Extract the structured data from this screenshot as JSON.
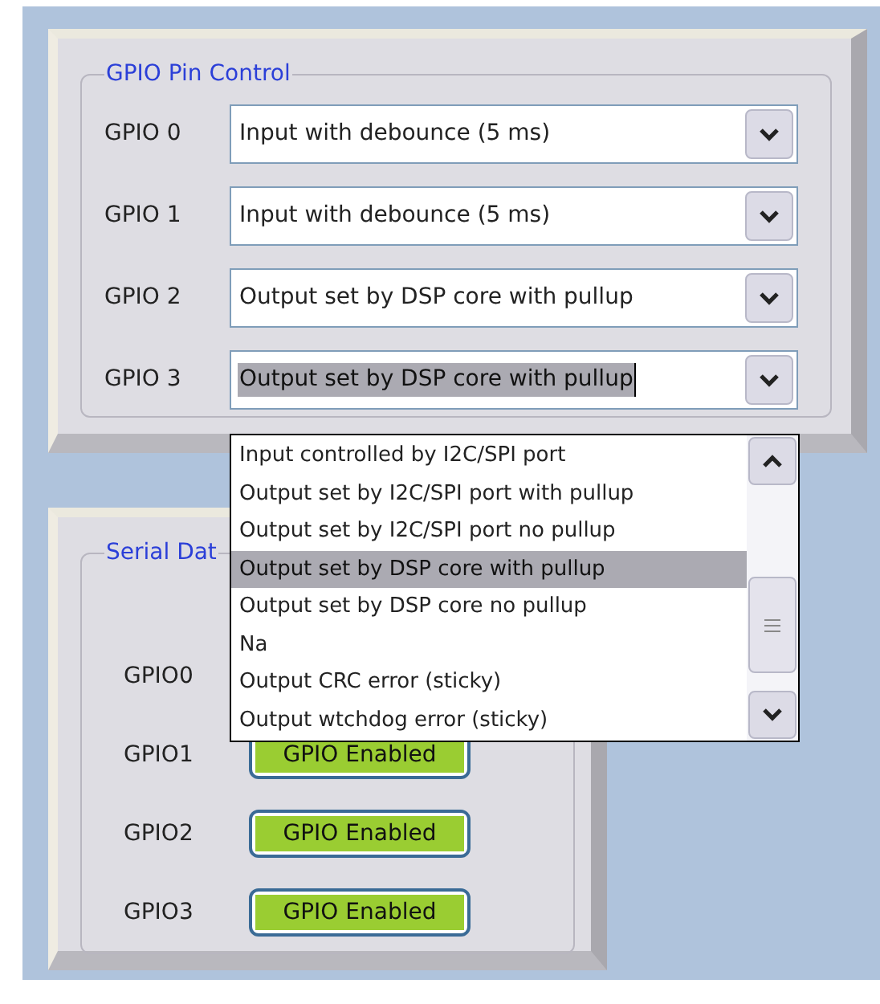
{
  "pin_control": {
    "title": "GPIO Pin Control",
    "pins": [
      {
        "label": "GPIO 0",
        "value": "Input with debounce (5 ms)",
        "focused": false
      },
      {
        "label": "GPIO 1",
        "value": "Input with debounce (5 ms)",
        "focused": false
      },
      {
        "label": "GPIO 2",
        "value": "Output set by DSP core with pullup",
        "focused": false
      },
      {
        "label": "GPIO 3",
        "value": "Output set by DSP core with pullup",
        "focused": true
      }
    ]
  },
  "dropdown": {
    "options": [
      {
        "label": "Input controlled by I2C/SPI port",
        "selected": false
      },
      {
        "label": "Output set by I2C/SPI port with pullup",
        "selected": false
      },
      {
        "label": "Output set by I2C/SPI port no pullup",
        "selected": false
      },
      {
        "label": "Output set by DSP core with pullup",
        "selected": true
      },
      {
        "label": "Output set by DSP core no pullup",
        "selected": false
      },
      {
        "label": "Na",
        "selected": false
      },
      {
        "label": "Output CRC error (sticky)",
        "selected": false
      },
      {
        "label": "Output wtchdog error (sticky)",
        "selected": false
      }
    ]
  },
  "serial_data": {
    "title": "Serial Dat",
    "rows": [
      {
        "label": "GPIO0"
      },
      {
        "label": "GPIO1",
        "indicator": "GPIO Enabled"
      },
      {
        "label": "GPIO2",
        "indicator": "GPIO Enabled"
      },
      {
        "label": "GPIO3",
        "indicator": "GPIO Enabled"
      }
    ]
  }
}
